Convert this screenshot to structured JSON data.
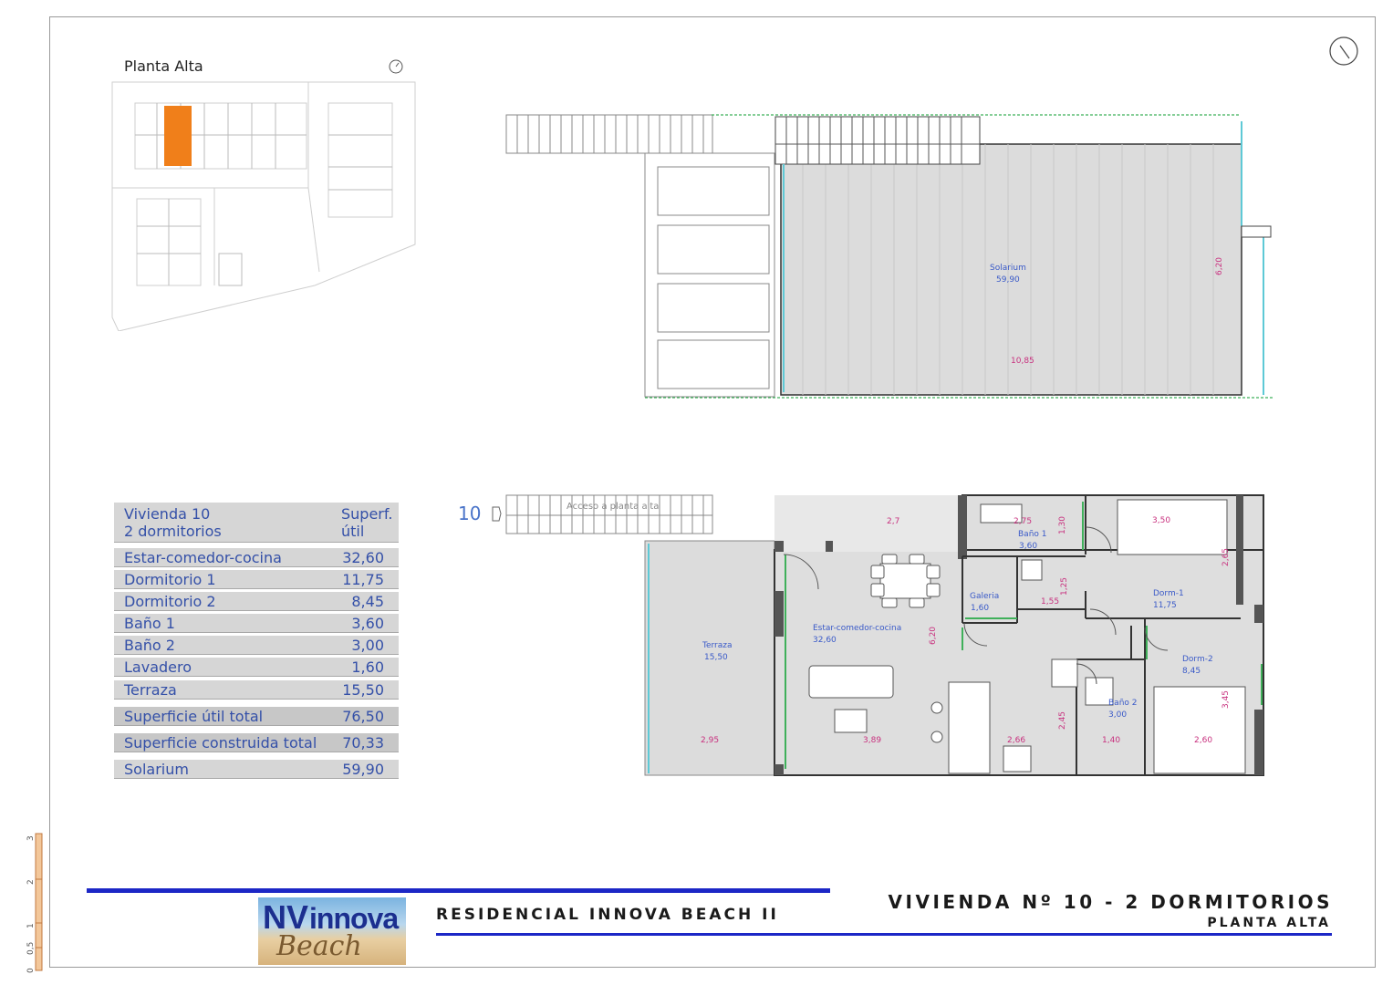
{
  "keyplan": {
    "title": "Planta Alta"
  },
  "table": {
    "header_label_1": "Vivienda 10",
    "header_label_2": "2 dormitorios",
    "header_value_1": "Superf.",
    "header_value_2": "útil",
    "rows": [
      {
        "label": "Estar-comedor-cocina",
        "value": "32,60"
      },
      {
        "label": "Dormitorio 1",
        "value": "11,75"
      },
      {
        "label": "Dormitorio 2",
        "value": "8,45"
      },
      {
        "label": "Baño 1",
        "value": "3,60"
      },
      {
        "label": "Baño 2",
        "value": "3,00"
      },
      {
        "label": "Lavadero",
        "value": "1,60"
      },
      {
        "label": "Terraza",
        "value": "15,50"
      }
    ],
    "util_total": {
      "label": "Superficie útil total",
      "value": "76,50"
    },
    "construida_total": {
      "label": "Superficie construida total",
      "value": "70,33"
    },
    "solarium": {
      "label": "Solarium",
      "value": "59,90"
    }
  },
  "solarium_plan": {
    "room": "Solarium",
    "area": "59,90",
    "dim_width": "10,85",
    "dim_height": "6,20"
  },
  "floor_plan": {
    "unit_number": "10",
    "access_label": "Acceso a planta alta",
    "rooms": {
      "estar": {
        "name": "Estar-comedor-cocina",
        "area": "32,60"
      },
      "terraza": {
        "name": "Terraza",
        "area": "15,50"
      },
      "bano1": {
        "name": "Baño 1",
        "area": "3,60"
      },
      "galeria": {
        "name": "Galeria",
        "area": "1,60"
      },
      "dorm1": {
        "name": "Dorm-1",
        "area": "11,75"
      },
      "dorm2": {
        "name": "Dorm-2",
        "area": "8,45"
      },
      "bano2": {
        "name": "Baño 2",
        "area": "3,00"
      }
    },
    "dims": {
      "d_295": "2,95",
      "d_389": "3,89",
      "d_266": "2,66",
      "d_140": "1,40",
      "d_260": "2,60",
      "d_275": "2,75",
      "d_130": "1,30",
      "d_350": "3,50",
      "d_265": "2,65",
      "d_155": "1,55",
      "d_125": "1,25",
      "d_620": "6,20",
      "d_245": "2,45",
      "d_345": "3,45",
      "d_2x": "2,7"
    }
  },
  "scale": {
    "marks": [
      "0",
      "0,5",
      "1",
      "2",
      "3"
    ]
  },
  "footer": {
    "residence": "RESIDENCIAL INNOVA BEACH II",
    "title": "VIVIENDA Nº 10 - 2 DORMITORIOS",
    "subtitle": "PLANTA ALTA",
    "logo_nv": "NV",
    "logo_innova": "innova",
    "logo_beach": "Beach"
  },
  "colors": {
    "accent_blue": "#1c27c6",
    "highlight_orange": "#f07f1a",
    "dimension_pink": "#c8307e",
    "label_blue": "#3a5ac8"
  }
}
